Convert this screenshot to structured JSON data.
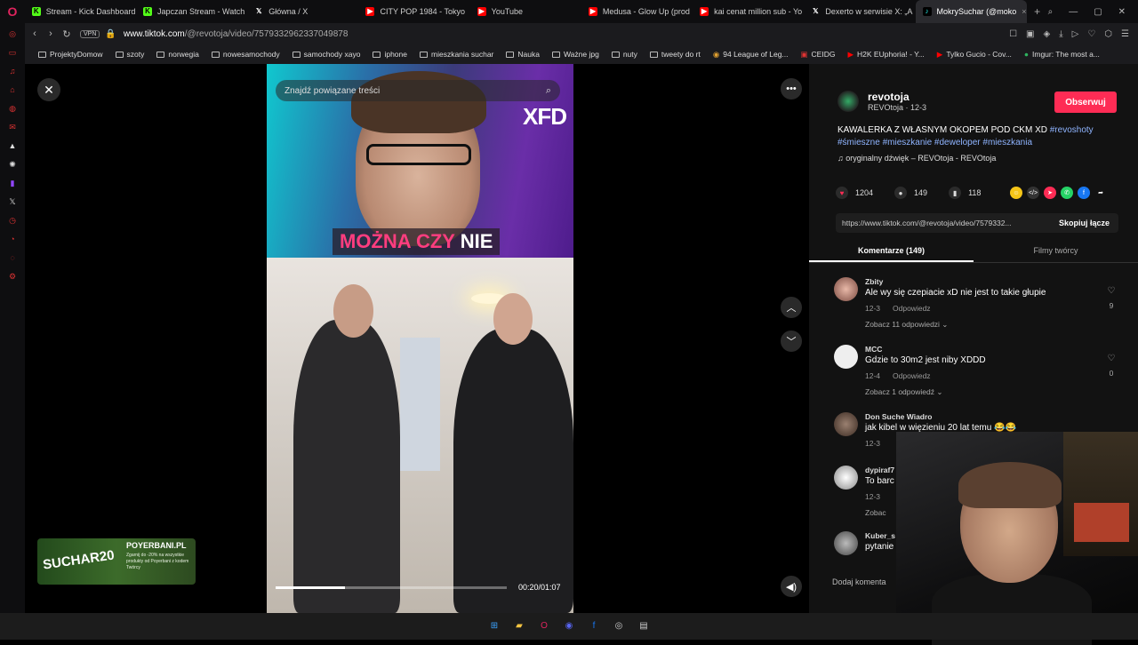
{
  "tabs": [
    {
      "label": "Stream - Kick Dashboard",
      "icon": "kick-icon",
      "active": false
    },
    {
      "label": "Japczan Stream - Watch",
      "icon": "kick-icon",
      "active": false
    },
    {
      "label": "Główna / X",
      "icon": "x-icon",
      "active": false
    },
    {
      "label": "CITY POP 1984 - Tokyo",
      "icon": "youtube-icon",
      "active": false
    },
    {
      "label": "YouTube",
      "icon": "youtube-icon",
      "active": false
    },
    {
      "label": "Medusa - Glow Up (prod",
      "icon": "youtube-icon",
      "active": false
    },
    {
      "label": "kai cenat million sub - Yo",
      "icon": "youtube-icon",
      "active": false
    },
    {
      "label": "Dexerto w serwisie X: „A",
      "icon": "x-icon",
      "active": false
    },
    {
      "label": "MokrySuchar (@moko",
      "icon": "tiktok-icon",
      "active": true
    }
  ],
  "address": {
    "vpn_label": "VPN",
    "url_host": "www.tiktok.com",
    "url_path": "/@revotoja/video/7579332962337049878"
  },
  "bookmarks": [
    "ProjektyDomow",
    "szoty",
    "norwegia",
    "nowesamochody",
    "samochody xayo",
    "iphone",
    "mieszkania suchar",
    "Nauka",
    "Ważne jpg",
    "nuty",
    "tweety do rt",
    "94 League of Leg...",
    "CEIDG",
    "H2K EUphoria! - Y...",
    "Tylko Gucio - Cov...",
    "Imgur: The most a..."
  ],
  "player": {
    "search_placeholder": "Znajdź powiązane treści",
    "overlay_brand": "XFD",
    "caption_part1": "MOŻNA CZY",
    "caption_part2": "NIE",
    "time": "00:20/01:07",
    "progress": 0.3
  },
  "promo": {
    "code": "SUCHAR20",
    "brand": "POYERBANI.PL",
    "text": "Zgarnij do -20% na wszystkie produkty od Poyerbani z kodem Twórcy"
  },
  "post": {
    "author_name": "revotoja",
    "author_sub": "REVOtoja · 12-3",
    "follow_label": "Obserwuj",
    "description": "KAWALERKA Z WŁASNYM OKOPEM POD CKM XD",
    "hashtags_line1": "#revoshoty",
    "hashtags_line2": "#śmieszne #mieszkanie #deweloper #mieszkania",
    "music": "oryginalny dźwięk – REVOtoja - REVOtoja",
    "likes": "1204",
    "comments": "149",
    "saves": "118",
    "link": "https://www.tiktok.com/@revotoja/video/7579332...",
    "copy_label": "Skopiuj łącze"
  },
  "panel_tabs": {
    "comments": "Komentarze (149)",
    "creator_videos": "Filmy twórcy"
  },
  "comments": [
    {
      "name": "Zbity",
      "text": "Ale wy się czepiacie xD nie jest to takie głupie",
      "date": "12-3",
      "reply": "Odpowiedz",
      "replies": "Zobacz 11 odpowiedzi ⌄",
      "likes": "9"
    },
    {
      "name": "MCC",
      "text": "Gdzie to 30m2 jest niby XDDD",
      "date": "12-4",
      "reply": "Odpowiedz",
      "replies": "Zobacz 1 odpowiedź ⌄",
      "likes": "0"
    },
    {
      "name": "Don Suche Wiadro",
      "text": "jak kibel w więzieniu 20 lat temu 😂😂",
      "date": "12-3",
      "reply": "",
      "replies": "",
      "likes": ""
    },
    {
      "name": "dypiraf7",
      "text": "To barc",
      "date": "12-3",
      "reply": "",
      "replies": "Zobac",
      "likes": ""
    },
    {
      "name": "Kuber_s",
      "text": "pytanie",
      "date": "",
      "reply": "",
      "replies": "",
      "likes": ""
    }
  ],
  "add_comment_placeholder": "Dodaj komenta"
}
